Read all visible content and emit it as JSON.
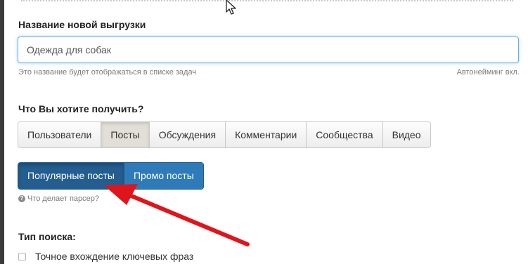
{
  "form": {
    "name_label": "Название новой выгрузки",
    "name_value": "Одежда для собак",
    "name_hint": "Это название будет отображаться в списке задач",
    "autonaming_hint": "Автонейминг вкл.",
    "what_label": "Что Вы хотите получить?",
    "tabs": [
      {
        "label": "Пользователи",
        "active": false
      },
      {
        "label": "Посты",
        "active": true
      },
      {
        "label": "Обсуждения",
        "active": false
      },
      {
        "label": "Комментарии",
        "active": false
      },
      {
        "label": "Сообщества",
        "active": false
      },
      {
        "label": "Видео",
        "active": false
      }
    ],
    "sub_buttons": [
      {
        "label": "Популярные посты",
        "active": true
      },
      {
        "label": "Промо посты",
        "active": false
      }
    ],
    "parser_help": "Что делает парсер?",
    "search_type_label": "Тип поиска:",
    "exact_match_label": "Точное вхождение ключевых фраз",
    "exact_match_checked": false
  },
  "icons": {
    "cursor": "mouse-cursor-icon",
    "help": "question-circle-icon",
    "annotation": "red-arrow"
  },
  "colors": {
    "primary_button": "#2f7ab8",
    "primary_button_active": "#245d8f",
    "active_tab": "#e2dfd6",
    "input_focus": "#66afe9",
    "annotation_arrow": "#e0141b"
  }
}
